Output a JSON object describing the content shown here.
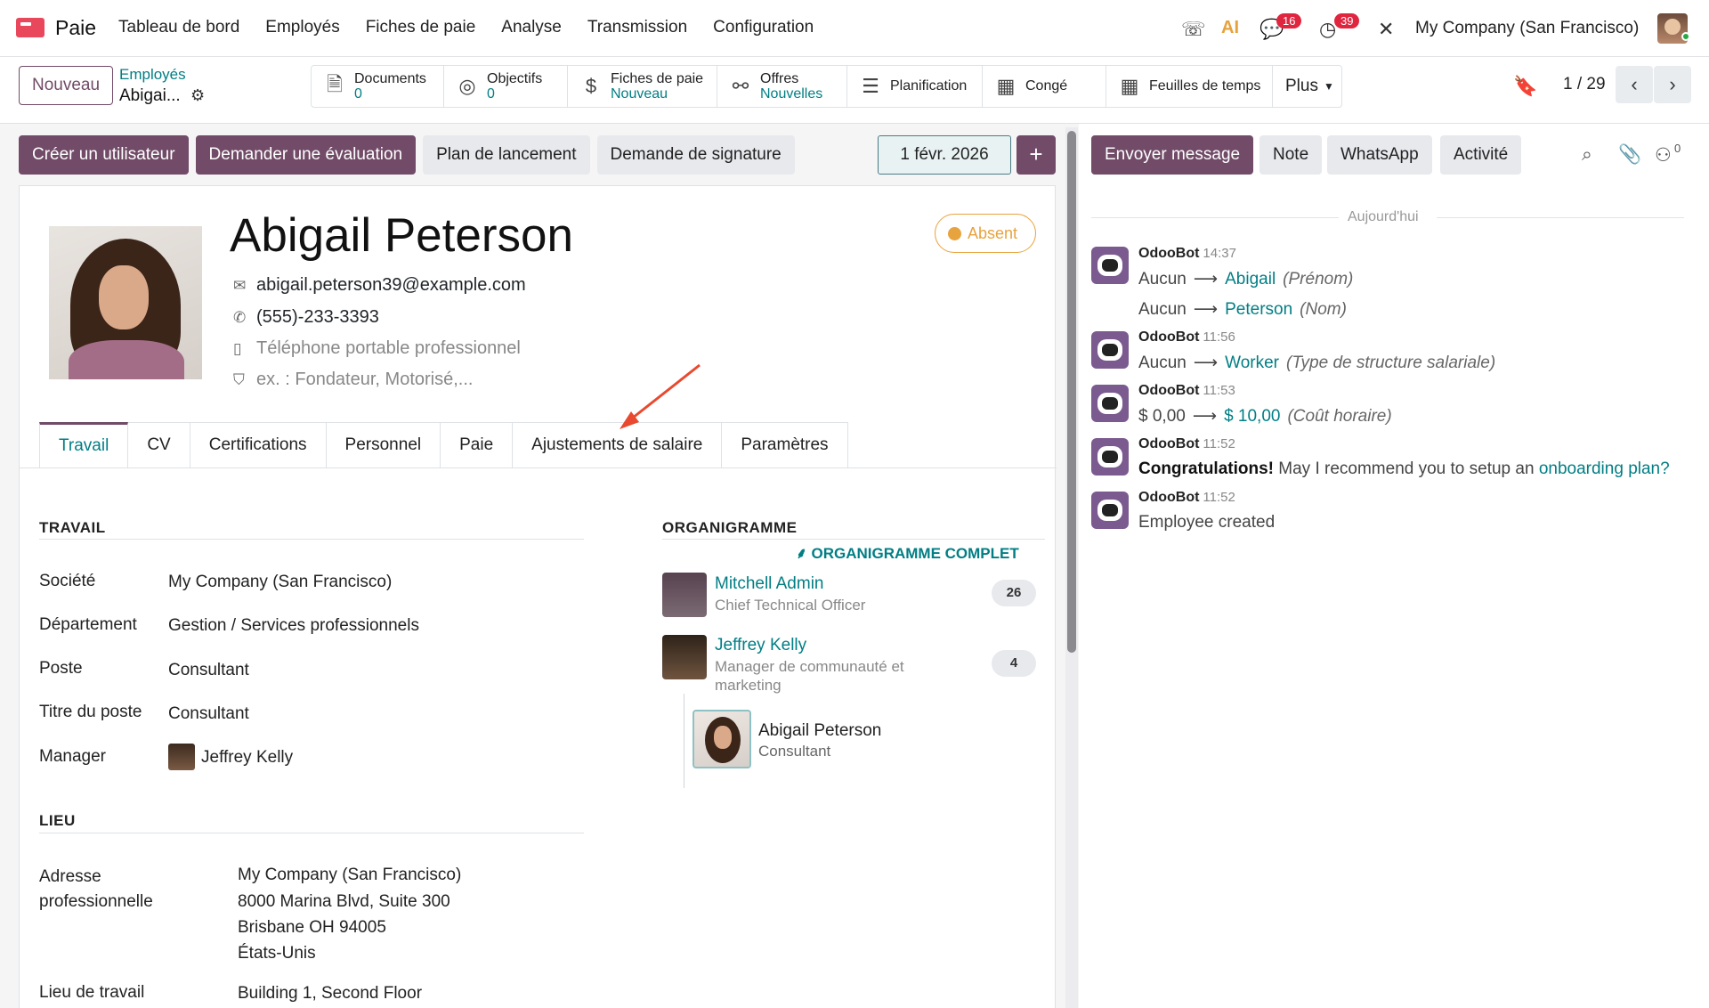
{
  "nav": {
    "app_name": "Paie",
    "menu": [
      "Tableau de bord",
      "Employés",
      "Fiches de paie",
      "Analyse",
      "Transmission",
      "Configuration"
    ],
    "messages_badge": "16",
    "activities_badge": "39",
    "ai_label": "AI",
    "company": "My Company (San Francisco)"
  },
  "control": {
    "new_button": "Nouveau",
    "breadcrumb_parent": "Employés",
    "breadcrumb_current": "Abigai...",
    "smart_buttons": [
      {
        "label": "Documents",
        "value": "0",
        "icon": "document-icon"
      },
      {
        "label": "Objectifs",
        "value": "0",
        "icon": "target-icon"
      },
      {
        "label": "Fiches de paie",
        "value": "Nouveau",
        "icon": "dollar-icon"
      },
      {
        "label": "Offres",
        "value": "Nouvelles",
        "icon": "handshake-icon"
      },
      {
        "label": "Planification",
        "icon": "planning-icon"
      },
      {
        "label": "Congé",
        "icon": "calendar-icon"
      },
      {
        "label": "Feuilles de temps",
        "icon": "calendar-icon"
      },
      {
        "label": "Plus"
      }
    ],
    "pager": "1 / 29"
  },
  "actions": {
    "create_user": "Créer un utilisateur",
    "ask_review": "Demander une évaluation",
    "launch_plan": "Plan de lancement",
    "signature_request": "Demande de signature",
    "date": "1 févr. 2026"
  },
  "employee": {
    "name": "Abigail Peterson",
    "status": "Absent",
    "email": "abigail.peterson39@example.com",
    "phone": "(555)-233-3393",
    "mobile_placeholder": "Téléphone portable professionnel",
    "tags_placeholder": "ex. : Fondateur, Motorisé,..."
  },
  "tabs": [
    "Travail",
    "CV",
    "Certifications",
    "Personnel",
    "Paie",
    "Ajustements de salaire",
    "Paramètres"
  ],
  "work": {
    "section_title": "TRAVAIL",
    "fields": [
      {
        "label": "Société",
        "value": "My Company (San Francisco)"
      },
      {
        "label": "Département",
        "value": "Gestion / Services professionnels"
      },
      {
        "label": "Poste",
        "value": "Consultant"
      },
      {
        "label": "Titre du poste",
        "value": "Consultant"
      },
      {
        "label": "Manager",
        "value": "Jeffrey Kelly"
      }
    ]
  },
  "location": {
    "section_title": "LIEU",
    "address_label": "Adresse professionnelle",
    "address_lines": [
      "My Company (San Francisco)",
      "8000 Marina Blvd, Suite 300",
      "Brisbane OH 94005",
      "États-Unis"
    ],
    "workplace_label": "Lieu de travail",
    "workplace_value": "Building 1, Second Floor"
  },
  "org": {
    "title": "ORGANIGRAMME",
    "full_link": "ORGANIGRAMME COMPLET",
    "people": [
      {
        "name": "Mitchell Admin",
        "job": "Chief Technical Officer",
        "count": "26"
      },
      {
        "name": "Jeffrey Kelly",
        "job": "Manager de communauté et marketing",
        "count": "4"
      }
    ],
    "self": {
      "name": "Abigail Peterson",
      "job": "Consultant"
    }
  },
  "chatter": {
    "send_message": "Envoyer message",
    "note": "Note",
    "whatsapp": "WhatsApp",
    "activity": "Activité",
    "follower_count": "0",
    "today": "Aujourd'hui",
    "messages": [
      {
        "author": "OdooBot",
        "time": "14:37"
      },
      {
        "author": "OdooBot",
        "time": "11:56"
      },
      {
        "author": "OdooBot",
        "time": "11:53"
      },
      {
        "author": "OdooBot",
        "time": "11:52"
      },
      {
        "author": "OdooBot",
        "time": "11:52"
      }
    ],
    "changes": [
      {
        "old": "Aucun",
        "new": "Abigail",
        "field": "(Prénom)"
      },
      {
        "old": "Aucun",
        "new": "Peterson",
        "field": "(Nom)"
      },
      {
        "old": "Aucun",
        "new": "Worker",
        "field": "(Type de structure salariale)"
      },
      {
        "old": "$ 0,00",
        "new": "$ 10,00",
        "field": "(Coût horaire)"
      }
    ],
    "congrats_bold": "Congratulations!",
    "congrats_text": "May I recommend you to setup an",
    "congrats_link": "onboarding plan?",
    "created": "Employee created"
  },
  "colors": {
    "primary": "#714b67",
    "link": "#017e84",
    "absent": "#e7a33e",
    "badge": "#e0253f"
  }
}
